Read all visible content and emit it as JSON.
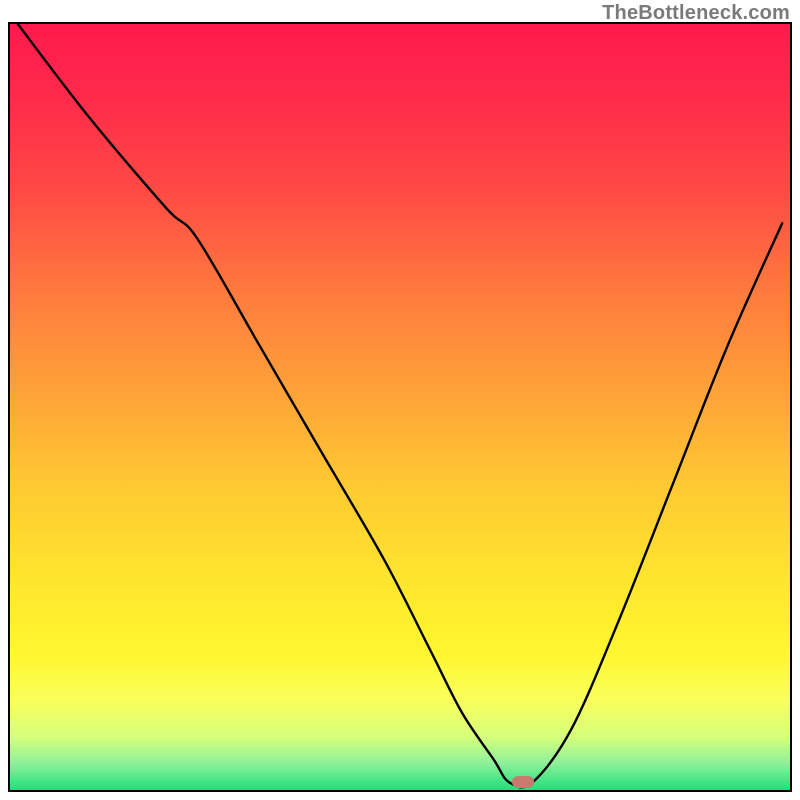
{
  "watermark": "TheBottleneck.com",
  "colors": {
    "gradient_stops": [
      {
        "offset": 0.0,
        "color": "#ff1a4d"
      },
      {
        "offset": 0.1,
        "color": "#ff2b4a"
      },
      {
        "offset": 0.22,
        "color": "#ff4b44"
      },
      {
        "offset": 0.35,
        "color": "#ff7a3e"
      },
      {
        "offset": 0.48,
        "color": "#ffa238"
      },
      {
        "offset": 0.6,
        "color": "#ffc832"
      },
      {
        "offset": 0.72,
        "color": "#ffe42e"
      },
      {
        "offset": 0.82,
        "color": "#fff62e"
      },
      {
        "offset": 0.88,
        "color": "#faff5a"
      },
      {
        "offset": 0.93,
        "color": "#d6ff7a"
      },
      {
        "offset": 0.965,
        "color": "#8ff09a"
      },
      {
        "offset": 1.0,
        "color": "#1fe07a"
      }
    ],
    "curve": "#000000",
    "marker": "#c97a6f"
  },
  "marker": {
    "x_pct": 65.8,
    "y_pct": 99.0
  },
  "chart_data": {
    "type": "line",
    "title": "",
    "xlabel": "",
    "ylabel": "",
    "xlim": [
      0,
      100
    ],
    "ylim": [
      0,
      100
    ],
    "note": "Axes unlabeled; V-shaped curve over a vertical red→green heat gradient. Values are percentage of plot width/height (0,0 = top-left of frame, y increases downward visually; listed here as y = 100 - visual_y so higher y = higher on chart).",
    "series": [
      {
        "name": "curve",
        "x": [
          1,
          10,
          20,
          24,
          32,
          40,
          48,
          54,
          58,
          62,
          64,
          67,
          72,
          78,
          85,
          92,
          99
        ],
        "y": [
          100,
          88,
          76,
          72,
          58,
          44,
          30,
          18,
          10,
          4,
          1,
          1,
          8,
          22,
          40,
          58,
          74
        ]
      }
    ],
    "marker_point": {
      "x": 65.8,
      "y": 1
    }
  }
}
